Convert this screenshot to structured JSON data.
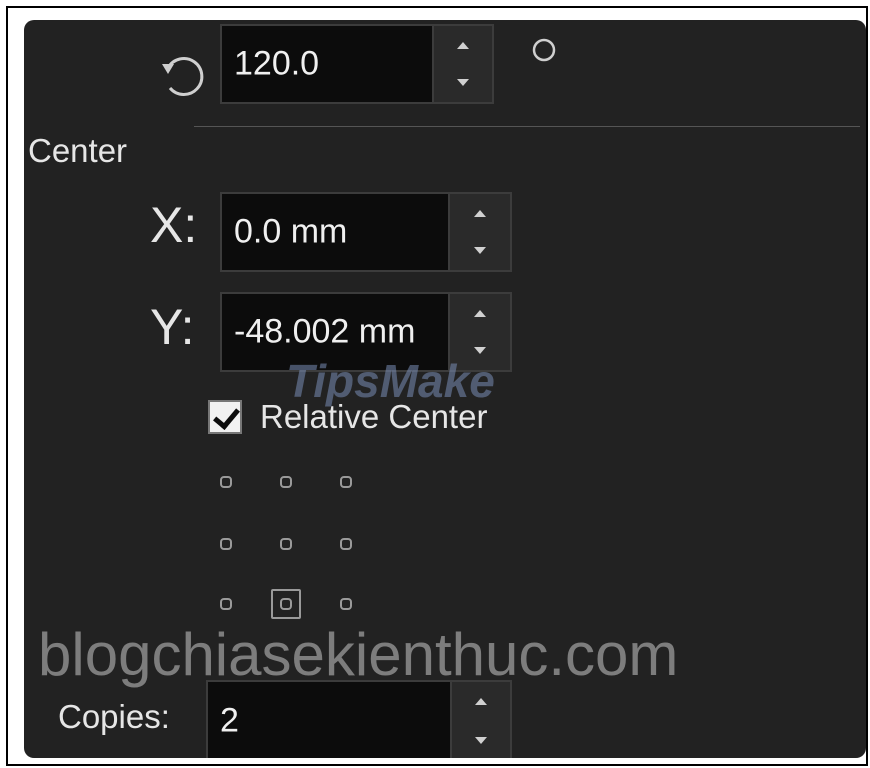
{
  "rotation": {
    "icon": "rotate-ccw-icon",
    "value": "120.0",
    "extra_icon": "circle-icon"
  },
  "center": {
    "section_label": "Center",
    "x": {
      "label": "X:",
      "value": "0.0 mm"
    },
    "y": {
      "label": "Y:",
      "value": "-48.002 mm"
    },
    "relative_center": {
      "label": "Relative Center",
      "checked": true
    }
  },
  "anchor_grid": {
    "rows": 3,
    "cols": 3,
    "selected": {
      "row": 3,
      "col": 2
    }
  },
  "copies": {
    "label": "Copies:",
    "value": "2"
  },
  "watermarks": {
    "logo": "TipsMake",
    "site": "blogchiasekienthuc.com"
  },
  "colors": {
    "panel_bg": "#222222",
    "field_bg": "#0c0c0c",
    "text": "#e6e6e6",
    "checkbox_bg": "#f2f2f2"
  }
}
